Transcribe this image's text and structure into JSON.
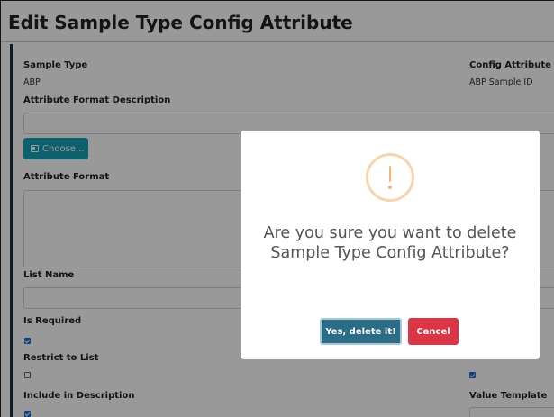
{
  "page": {
    "title": "Edit Sample Type Config Attribute"
  },
  "form": {
    "sample_type_label": "Sample Type",
    "sample_type_value": "ABP",
    "config_attribute_label": "Config Attribute",
    "config_attribute_value": "ABP Sample ID",
    "attr_format_desc_label": "Attribute Format Description",
    "choose_button_label": "Choose...",
    "attribute_format_label": "Attribute Format",
    "list_name_label": "List Name",
    "is_required_label": "Is Required",
    "is_required_checked": true,
    "restrict_to_list_label": "Restrict to List",
    "restrict_to_list_checked": false,
    "include_in_description_label": "Include in Description",
    "include_in_description_checked": true,
    "right_checkbox_checked": true,
    "value_template_label": "Value Template"
  },
  "dialog": {
    "message": "Are you sure you want to delete Sample Type Config Attribute?",
    "confirm_label": "Yes, delete it!",
    "cancel_label": "Cancel",
    "icon": "warning-icon",
    "colors": {
      "confirm": "#2b6d86",
      "cancel": "#dc3545",
      "warning": "#f8bb86"
    }
  }
}
